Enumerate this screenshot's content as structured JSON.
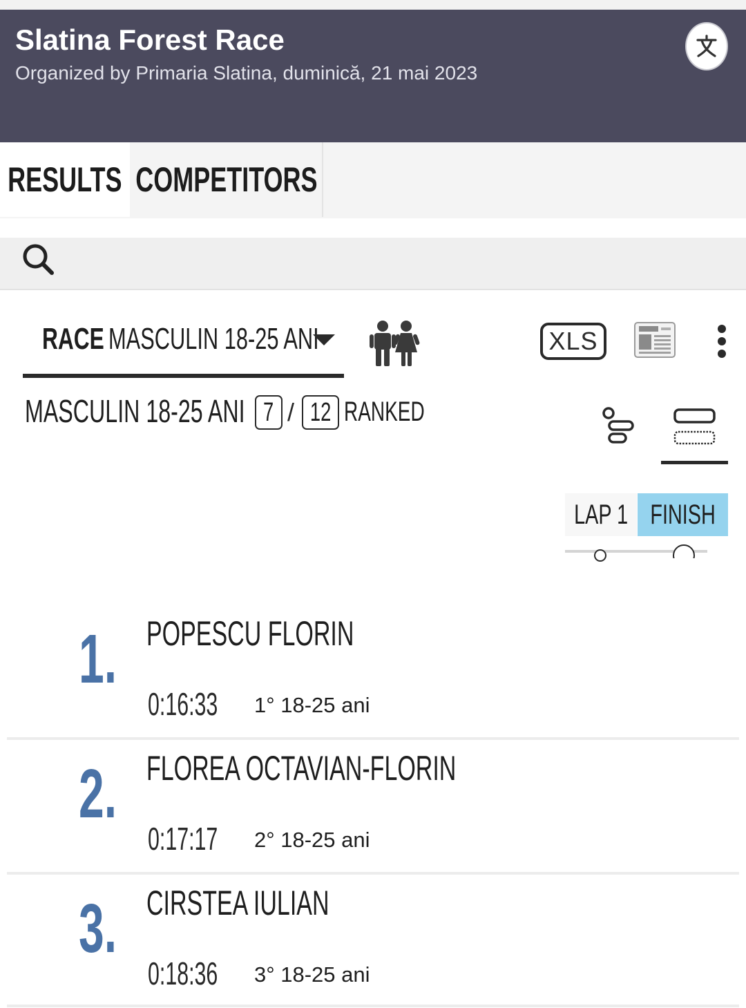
{
  "header": {
    "title": "Slatina Forest Race",
    "subtitle": "Organized by Primaria Slatina, duminică, 21 mai 2023",
    "translate_icon": "translate-icon"
  },
  "tabs": [
    {
      "label": "RESULTS",
      "active": true
    },
    {
      "label": "COMPETITORS",
      "active": false
    }
  ],
  "search": {
    "icon": "search-icon"
  },
  "race_selector": {
    "label": "RACE",
    "value": "MASCULIN 18-25 ANI"
  },
  "toolbar": {
    "xls_label": "XLS",
    "people_icon": "people-icon",
    "newspaper_icon": "newspaper-icon",
    "more_icon": "more-vertical-icon"
  },
  "summary": {
    "category": "MASCULIN 18-25 ANI",
    "ranked_count": "7",
    "total_count": "12",
    "separator": "/",
    "ranked_label": "RANKED"
  },
  "splits": {
    "options": [
      "LAP 1",
      "FINISH"
    ],
    "selected": "FINISH"
  },
  "colors": {
    "header_bg": "#4b4a5e",
    "rank_color": "#4a72a6",
    "active_split_bg": "#95d3ee"
  },
  "results": [
    {
      "rank": "1.",
      "name": "POPESCU FLORIN",
      "time": "0:16:33",
      "category_rank": "1° 18-25 ani"
    },
    {
      "rank": "2.",
      "name": "FLOREA OCTAVIAN-FLORIN",
      "time": "0:17:17",
      "category_rank": "2° 18-25 ani"
    },
    {
      "rank": "3.",
      "name": "CIRSTEA IULIAN",
      "time": "0:18:36",
      "category_rank": "3° 18-25 ani"
    }
  ]
}
